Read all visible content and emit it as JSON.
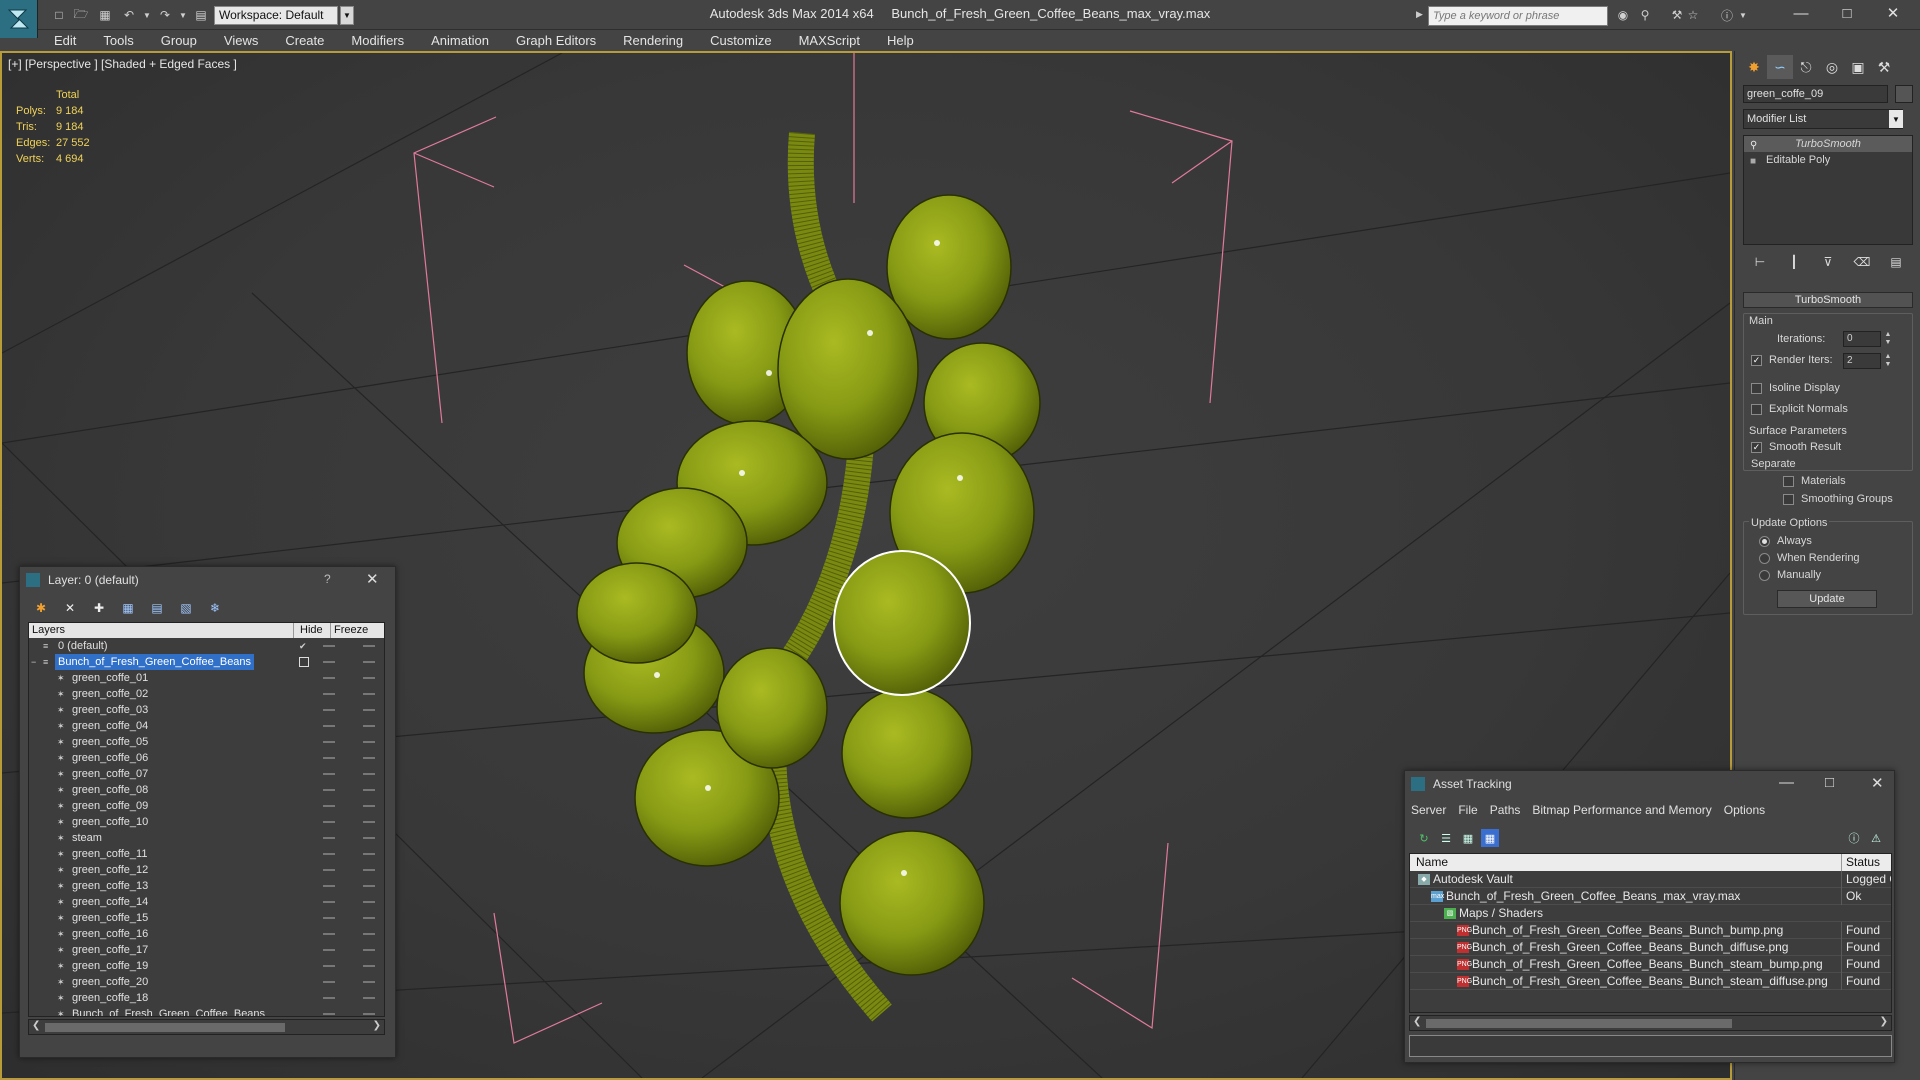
{
  "titlebar": {
    "app": "Autodesk 3ds Max  2014 x64",
    "file": "Bunch_of_Fresh_Green_Coffee_Beans_max_vray.max",
    "workspace": "Workspace: Default",
    "search_placeholder": "Type a keyword or phrase"
  },
  "menu": [
    "Edit",
    "Tools",
    "Group",
    "Views",
    "Create",
    "Modifiers",
    "Animation",
    "Graph Editors",
    "Rendering",
    "Customize",
    "MAXScript",
    "Help"
  ],
  "viewport": {
    "label": "[+] [Perspective ] [Shaded + Edged Faces ]",
    "stats": {
      "header": "Total",
      "rows": [
        {
          "k": "Polys:",
          "v": "9 184"
        },
        {
          "k": "Tris:",
          "v": "9 184"
        },
        {
          "k": "Edges:",
          "v": "27 552"
        },
        {
          "k": "Verts:",
          "v": "4 694"
        }
      ]
    }
  },
  "command_panel": {
    "object_name": "green_coffe_09",
    "modifier_list": "Modifier List",
    "stack": [
      "TurboSmooth",
      "Editable Poly"
    ],
    "rollout": "TurboSmooth",
    "main_group": "Main",
    "iterations_label": "Iterations:",
    "iterations_value": "0",
    "render_iters_label": "Render Iters:",
    "render_iters_value": "2",
    "isoline_display": "Isoline Display",
    "explicit_normals": "Explicit Normals",
    "surface_params": "Surface Parameters",
    "smooth_result": "Smooth Result",
    "separate": "Separate",
    "materials": "Materials",
    "smoothing_groups": "Smoothing Groups",
    "update_options": "Update Options",
    "always": "Always",
    "when_rendering": "When Rendering",
    "manually": "Manually",
    "update_button": "Update"
  },
  "layer_dialog": {
    "title": "Layer: 0 (default)",
    "help": "?",
    "columns": [
      "Layers",
      "Hide",
      "Freeze"
    ],
    "rows": [
      {
        "name": "0 (default)",
        "level": 0,
        "kind": "layer"
      },
      {
        "name": "Bunch_of_Fresh_Green_Coffee_Beans",
        "level": 0,
        "kind": "layer",
        "selected": true
      },
      {
        "name": "green_coffe_01",
        "level": 1,
        "kind": "object"
      },
      {
        "name": "green_coffe_02",
        "level": 1,
        "kind": "object"
      },
      {
        "name": "green_coffe_03",
        "level": 1,
        "kind": "object"
      },
      {
        "name": "green_coffe_04",
        "level": 1,
        "kind": "object"
      },
      {
        "name": "green_coffe_05",
        "level": 1,
        "kind": "object"
      },
      {
        "name": "green_coffe_06",
        "level": 1,
        "kind": "object"
      },
      {
        "name": "green_coffe_07",
        "level": 1,
        "kind": "object"
      },
      {
        "name": "green_coffe_08",
        "level": 1,
        "kind": "object"
      },
      {
        "name": "green_coffe_09",
        "level": 1,
        "kind": "object"
      },
      {
        "name": "green_coffe_10",
        "level": 1,
        "kind": "object"
      },
      {
        "name": "steam",
        "level": 1,
        "kind": "object"
      },
      {
        "name": "green_coffe_11",
        "level": 1,
        "kind": "object"
      },
      {
        "name": "green_coffe_12",
        "level": 1,
        "kind": "object"
      },
      {
        "name": "green_coffe_13",
        "level": 1,
        "kind": "object"
      },
      {
        "name": "green_coffe_14",
        "level": 1,
        "kind": "object"
      },
      {
        "name": "green_coffe_15",
        "level": 1,
        "kind": "object"
      },
      {
        "name": "green_coffe_16",
        "level": 1,
        "kind": "object"
      },
      {
        "name": "green_coffe_17",
        "level": 1,
        "kind": "object"
      },
      {
        "name": "green_coffe_19",
        "level": 1,
        "kind": "object"
      },
      {
        "name": "green_coffe_20",
        "level": 1,
        "kind": "object"
      },
      {
        "name": "green_coffe_18",
        "level": 1,
        "kind": "object"
      },
      {
        "name": "Bunch_of_Fresh_Green_Coffee_Beans",
        "level": 1,
        "kind": "object"
      }
    ]
  },
  "asset_dialog": {
    "title": "Asset Tracking",
    "menu": [
      "Server",
      "File",
      "Paths",
      "Bitmap Performance and Memory",
      "Options"
    ],
    "columns": [
      "Name",
      "Status"
    ],
    "rows": [
      {
        "name": "Autodesk Vault",
        "status": "Logged O",
        "level": 0,
        "icon": "vault-icon"
      },
      {
        "name": "Bunch_of_Fresh_Green_Coffee_Beans_max_vray.max",
        "status": "Ok",
        "level": 1,
        "icon": "max-file-icon"
      },
      {
        "name": "Maps / Shaders",
        "status": "",
        "level": 2,
        "icon": "maps-icon"
      },
      {
        "name": "Bunch_of_Fresh_Green_Coffee_Beans_Bunch_bump.png",
        "status": "Found",
        "level": 3,
        "icon": "png-icon"
      },
      {
        "name": "Bunch_of_Fresh_Green_Coffee_Beans_Bunch_diffuse.png",
        "status": "Found",
        "level": 3,
        "icon": "png-icon"
      },
      {
        "name": "Bunch_of_Fresh_Green_Coffee_Beans_Bunch_steam_bump.png",
        "status": "Found",
        "level": 3,
        "icon": "png-icon"
      },
      {
        "name": "Bunch_of_Fresh_Green_Coffee_Beans_Bunch_steam_diffuse.png",
        "status": "Found",
        "level": 3,
        "icon": "png-icon"
      }
    ]
  },
  "colors": {
    "ui_bg": "#444444",
    "viewport_border": "#b89c3a",
    "stats_text": "#f0d25a",
    "selection_blue": "#3070c8",
    "bean_green": "#8a9a18"
  }
}
